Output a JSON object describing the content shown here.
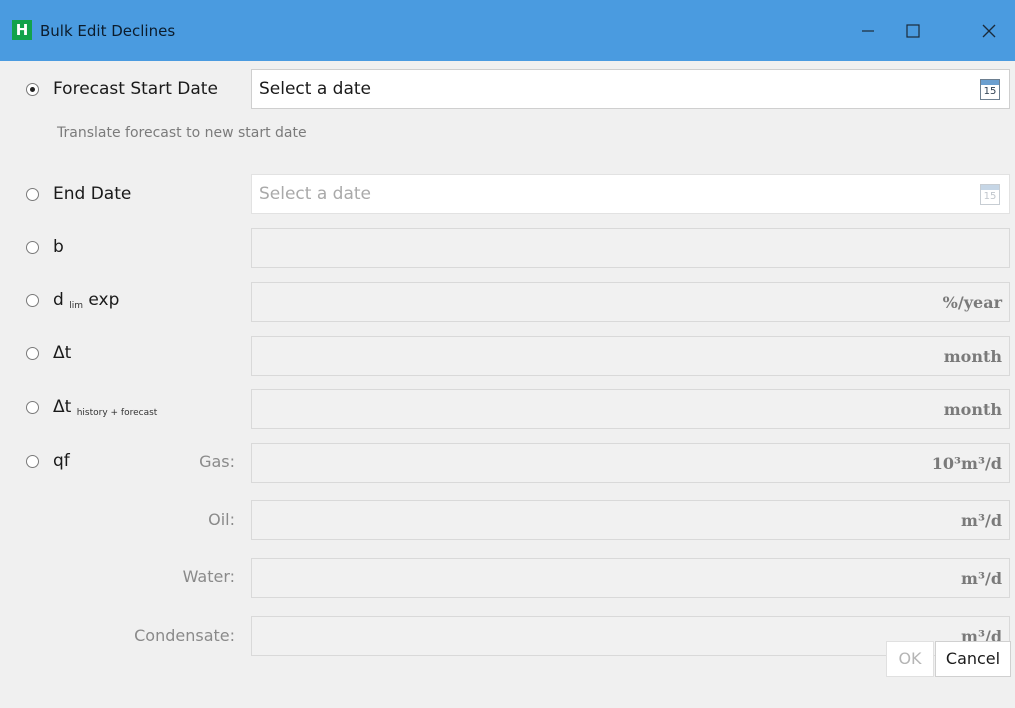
{
  "window": {
    "app_letter": "H",
    "title": "Bulk Edit Declines",
    "minimize_glyph": "—",
    "maximize_glyph": "☐",
    "close_glyph": "✕"
  },
  "options": {
    "forecast_start": {
      "label": "Forecast Start Date",
      "placeholder": "Select a date",
      "hint": "Translate forecast to new start date",
      "selected": true
    },
    "end_date": {
      "label": "End Date",
      "placeholder": "Select a date"
    },
    "b": {
      "label": "b"
    },
    "dlim": {
      "label_main": "d",
      "label_sub": "lim",
      "label_tail": "exp",
      "unit": "%/year"
    },
    "dt": {
      "label": "Δt",
      "unit": "month"
    },
    "dt_hf": {
      "label_main": "Δt",
      "label_sub": "history + forecast",
      "unit": "month"
    },
    "qf": {
      "label": "qf",
      "gas_label": "Gas:",
      "gas_unit": "10³m³/d",
      "oil_label": "Oil:",
      "oil_unit": "m³/d",
      "water_label": "Water:",
      "water_unit": "m³/d",
      "condensate_label": "Condensate:",
      "condensate_unit": "m³/d"
    }
  },
  "calendar_day": "15",
  "buttons": {
    "ok": "OK",
    "cancel": "Cancel"
  }
}
